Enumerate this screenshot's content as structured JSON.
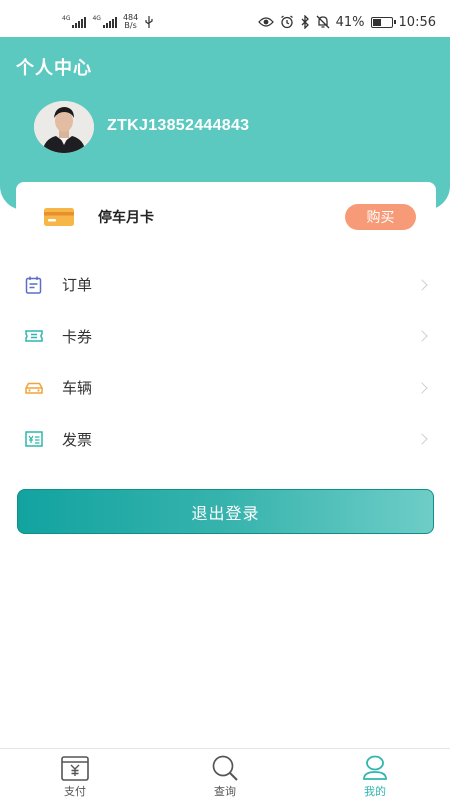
{
  "status_bar": {
    "signal1_label": "4G",
    "signal2_label": "4G",
    "net_speed_value": "484",
    "net_speed_unit": "B/s",
    "battery_percent": "41%",
    "time": "10:56"
  },
  "header": {
    "title": "个人中心",
    "username": "ZTKJ13852444843"
  },
  "card": {
    "title": "停车月卡",
    "buy_label": "购买"
  },
  "menu": {
    "items": [
      {
        "label": "订单",
        "icon": "calendar-icon",
        "color": "#5b6fc7"
      },
      {
        "label": "卡券",
        "icon": "ticket-icon",
        "color": "#2fb6ad"
      },
      {
        "label": "车辆",
        "icon": "car-icon",
        "color": "#f0a43a"
      },
      {
        "label": "发票",
        "icon": "invoice-icon",
        "color": "#2fb6ad"
      }
    ]
  },
  "logout_label": "退出登录",
  "tabs": [
    {
      "label": "支付",
      "icon": "wallet-icon",
      "active": false
    },
    {
      "label": "查询",
      "icon": "search-icon",
      "active": false
    },
    {
      "label": "我的",
      "icon": "user-icon",
      "active": true
    }
  ],
  "colors": {
    "header_bg": "#5cc9c1",
    "accent": "#2fb6ad",
    "buy_button": "#f79a78"
  }
}
